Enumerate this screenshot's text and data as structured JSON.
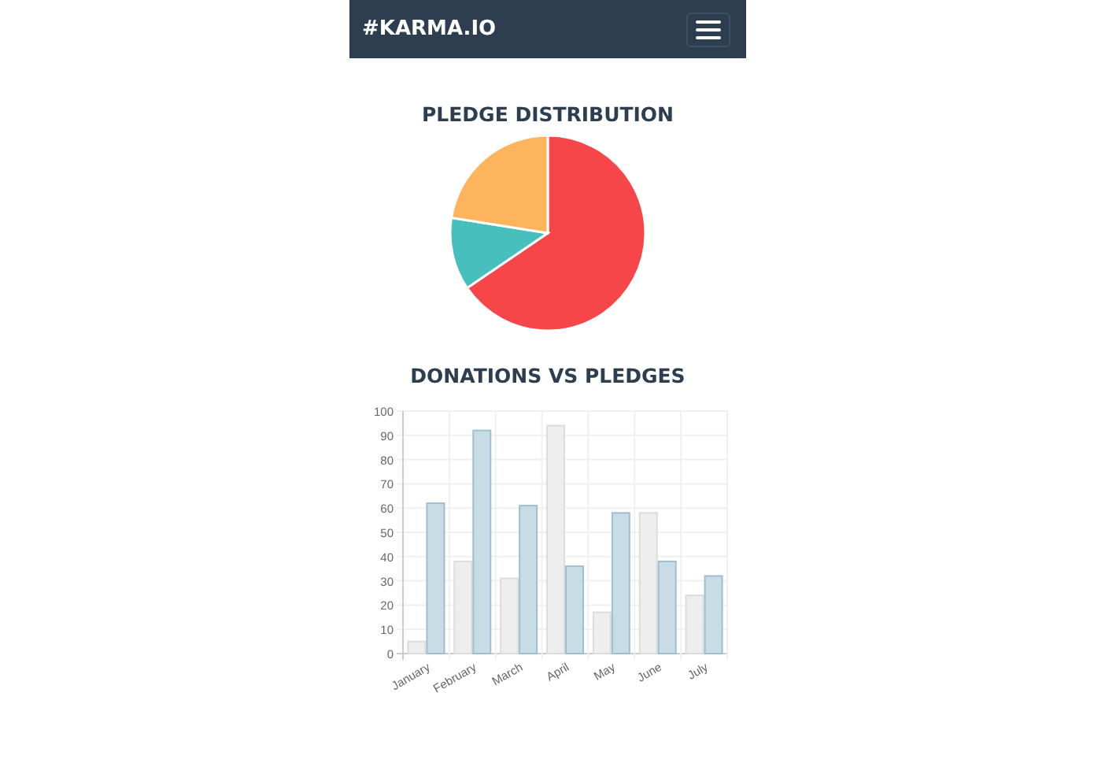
{
  "navbar": {
    "brand": "#KARMA.IO"
  },
  "pledge_distribution": {
    "title": "PLEDGE DISTRIBUTION"
  },
  "donations_vs_pledges": {
    "title": "DONATIONS VS PLEDGES",
    "chart_data": {
      "type": "bar",
      "categories": [
        "January",
        "February",
        "March",
        "April",
        "May",
        "June",
        "July"
      ],
      "series": [
        {
          "color": "#eeeeee",
          "values": [
            5,
            38,
            31,
            94,
            17,
            58,
            24
          ]
        },
        {
          "color": "#c8dce6",
          "values": [
            62,
            92,
            61,
            36,
            58,
            38,
            32
          ]
        }
      ],
      "ylim": [
        0,
        100
      ],
      "grid": true,
      "yticks": [
        0,
        10,
        20,
        30,
        40,
        50,
        60,
        70,
        80,
        90,
        100
      ]
    }
  }
}
